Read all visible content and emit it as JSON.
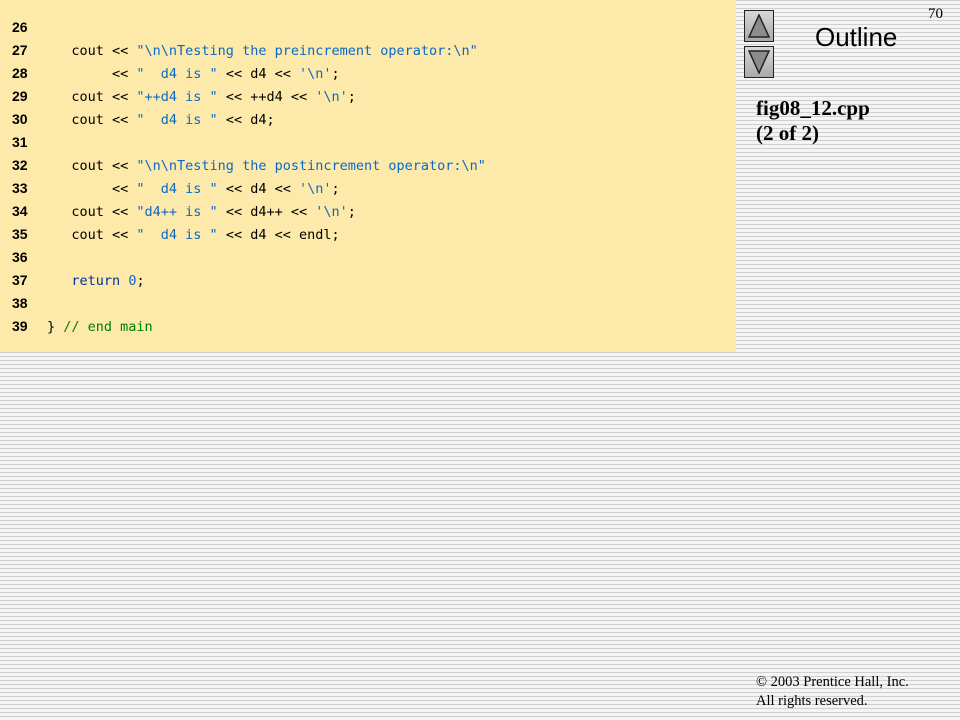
{
  "slide": {
    "page_number": "70",
    "outline_label": "Outline",
    "file_title": "fig08_12.cpp",
    "file_part": "(2 of 2)",
    "copyright": "© 2003 Prentice Hall, Inc.",
    "rights": "All rights reserved.",
    "icons": {
      "up": "triangle-up-icon",
      "down": "triangle-down-icon"
    }
  },
  "colors": {
    "code_background": "#fde9a9",
    "string": "#0a69c8",
    "keyword": "#0032a0",
    "comment": "#008000"
  },
  "code": [
    {
      "num": "26",
      "parts": []
    },
    {
      "num": "27",
      "parts": [
        {
          "t": "plain",
          "v": "   cout << "
        },
        {
          "t": "str",
          "v": "\"\\n\\nTesting the preincrement operator:\\n\""
        }
      ]
    },
    {
      "num": "28",
      "parts": [
        {
          "t": "plain",
          "v": "        << "
        },
        {
          "t": "str",
          "v": "\"  d4 is \""
        },
        {
          "t": "plain",
          "v": " << d4 << "
        },
        {
          "t": "str",
          "v": "'\\n'"
        },
        {
          "t": "plain",
          "v": ";"
        }
      ]
    },
    {
      "num": "29",
      "parts": [
        {
          "t": "plain",
          "v": "   cout << "
        },
        {
          "t": "str",
          "v": "\"++d4 is \""
        },
        {
          "t": "plain",
          "v": " << ++d4 << "
        },
        {
          "t": "str",
          "v": "'\\n'"
        },
        {
          "t": "plain",
          "v": ";"
        }
      ]
    },
    {
      "num": "30",
      "parts": [
        {
          "t": "plain",
          "v": "   cout << "
        },
        {
          "t": "str",
          "v": "\"  d4 is \""
        },
        {
          "t": "plain",
          "v": " << d4;"
        }
      ]
    },
    {
      "num": "31",
      "parts": []
    },
    {
      "num": "32",
      "parts": [
        {
          "t": "plain",
          "v": "   cout << "
        },
        {
          "t": "str",
          "v": "\"\\n\\nTesting the postincrement operator:\\n\""
        }
      ]
    },
    {
      "num": "33",
      "parts": [
        {
          "t": "plain",
          "v": "        << "
        },
        {
          "t": "str",
          "v": "\"  d4 is \""
        },
        {
          "t": "plain",
          "v": " << d4 << "
        },
        {
          "t": "str",
          "v": "'\\n'"
        },
        {
          "t": "plain",
          "v": ";"
        }
      ]
    },
    {
      "num": "34",
      "parts": [
        {
          "t": "plain",
          "v": "   cout << "
        },
        {
          "t": "str",
          "v": "\"d4++ is \""
        },
        {
          "t": "plain",
          "v": " << d4++ << "
        },
        {
          "t": "str",
          "v": "'\\n'"
        },
        {
          "t": "plain",
          "v": ";"
        }
      ]
    },
    {
      "num": "35",
      "parts": [
        {
          "t": "plain",
          "v": "   cout << "
        },
        {
          "t": "str",
          "v": "\"  d4 is \""
        },
        {
          "t": "plain",
          "v": " << d4 << endl;"
        }
      ]
    },
    {
      "num": "36",
      "parts": []
    },
    {
      "num": "37",
      "parts": [
        {
          "t": "plain",
          "v": "   "
        },
        {
          "t": "kw",
          "v": "return"
        },
        {
          "t": "plain",
          "v": " "
        },
        {
          "t": "str",
          "v": "0"
        },
        {
          "t": "plain",
          "v": ";"
        }
      ]
    },
    {
      "num": "38",
      "parts": []
    },
    {
      "num": "39",
      "parts": [
        {
          "t": "plain",
          "v": "} "
        },
        {
          "t": "com",
          "v": "// end main"
        }
      ]
    }
  ]
}
